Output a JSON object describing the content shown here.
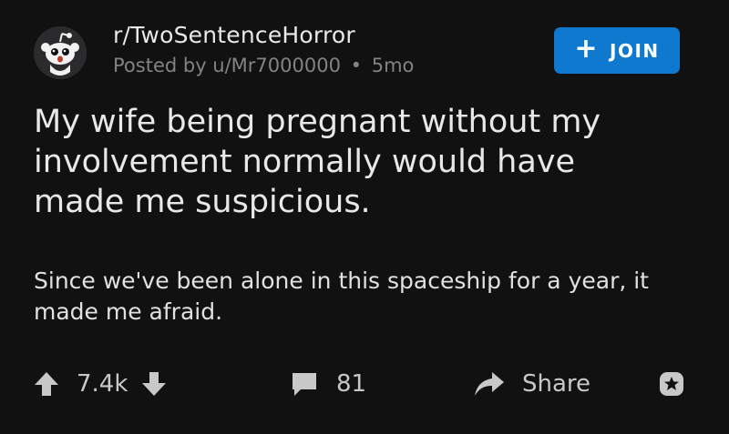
{
  "post": {
    "subreddit": "r/TwoSentenceHorror",
    "posted_by": "Posted by u/Mr7000000",
    "separator": "•",
    "age": "5mo",
    "join_label": "JOIN",
    "title": "My wife being pregnant without my involvement normally would have made me suspicious.",
    "body": "Since we've been alone in this spaceship for a year, it made me afraid."
  },
  "actions": {
    "score": "7.4k",
    "comments": "81",
    "share_label": "Share"
  },
  "icons": {
    "avatar": "snoo-avatar-icon",
    "join": "plus-icon",
    "upvote": "arrow-up-icon",
    "downvote": "arrow-down-icon",
    "comments": "speech-bubble-icon",
    "share": "share-arrow-icon",
    "award": "award-icon"
  },
  "colors": {
    "background": "#111112",
    "join_button": "#0f79d0",
    "meta_text": "#818384",
    "primary_text": "#e8e8e8"
  }
}
